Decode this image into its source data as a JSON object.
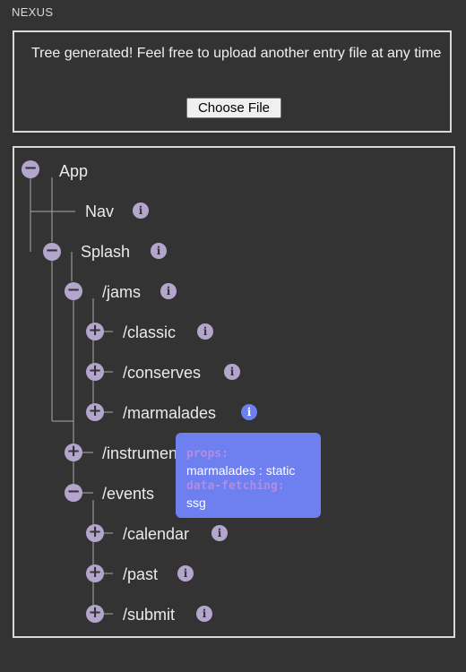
{
  "app": {
    "title": "NEXUS"
  },
  "upload": {
    "message": "Tree generated! Feel free to upload another entry file at any time",
    "button_label": "Choose File"
  },
  "tree": {
    "toggle_expanded": "−",
    "toggle_collapsed": "+",
    "info_glyph": "i",
    "nodes": {
      "app": "App",
      "nav": "Nav",
      "splash": "Splash",
      "jams": "/jams",
      "classic": "/classic",
      "conserves": "/conserves",
      "marmalades": "/marmalades",
      "instruments": "/instruments",
      "events": "/events",
      "calendar": "/calendar",
      "past": "/past",
      "submit": "/submit"
    }
  },
  "tooltip": {
    "props_label": "props:",
    "props_value": "marmalades : static",
    "fetching_label": "data-fetching:",
    "fetching_value": "ssg"
  },
  "colors": {
    "background": "#333333",
    "toggle": "#b4a5cd",
    "accent": "#6e7ff0"
  }
}
